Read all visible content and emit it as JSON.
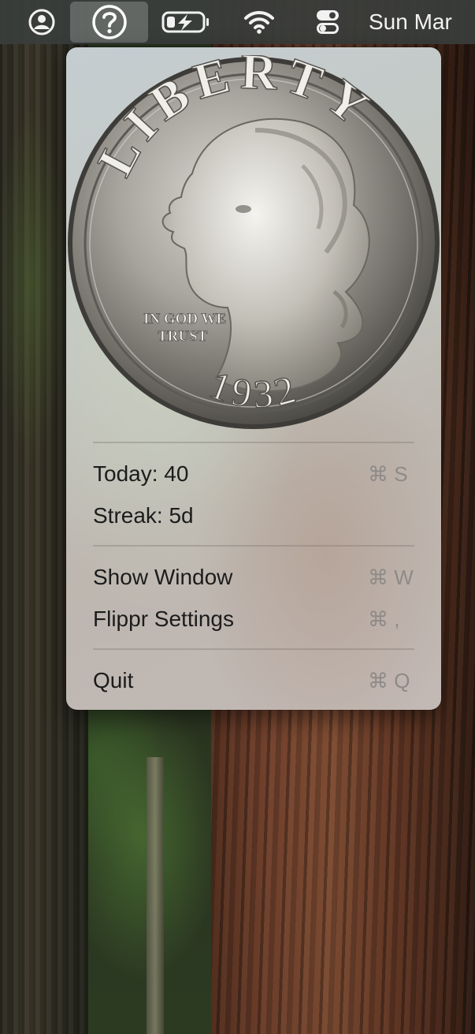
{
  "menubar": {
    "icons": [
      "user-circle-icon",
      "help-question-icon",
      "battery-charging-icon",
      "wifi-icon",
      "control-center-icon"
    ],
    "clock": "Sun Mar"
  },
  "menu": {
    "coin": {
      "top_legend": "LIBERTY",
      "motto": "IN GOD WE TRUST",
      "year": "1932"
    },
    "items": [
      {
        "label": "Today: 40",
        "shortcut": "⌘ S"
      },
      {
        "label": "Streak: 5d",
        "shortcut": ""
      },
      {
        "label": "Show Window",
        "shortcut": "⌘ W"
      },
      {
        "label": "Flippr Settings",
        "shortcut": "⌘ ,"
      },
      {
        "label": "Quit",
        "shortcut": "⌘ Q"
      }
    ]
  }
}
